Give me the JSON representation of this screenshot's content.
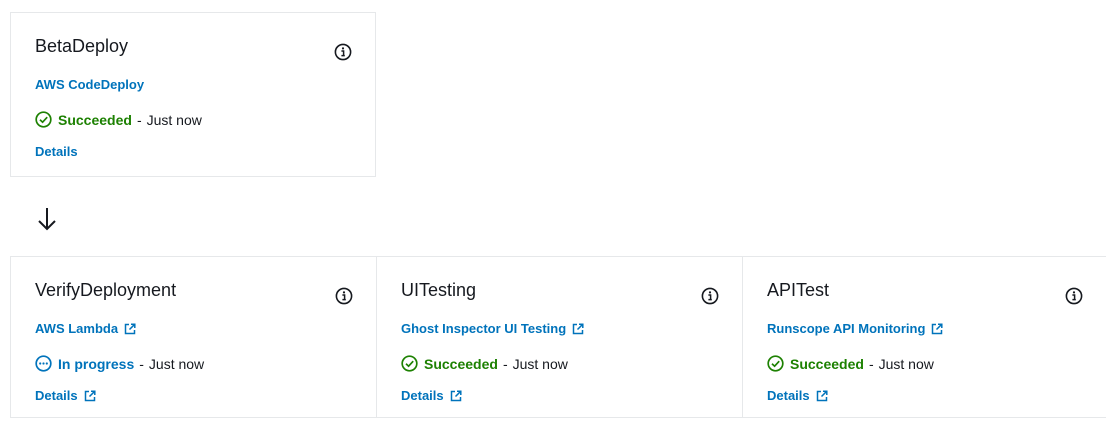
{
  "stages": [
    {
      "title": "BetaDeploy",
      "provider": "AWS CodeDeploy",
      "provider_external": false,
      "status": "Succeeded",
      "status_type": "succeeded",
      "separator": "-",
      "time": "Just now",
      "details": "Details",
      "details_external": false
    },
    {
      "title": "VerifyDeployment",
      "provider": "AWS Lambda",
      "provider_external": true,
      "status": "In progress",
      "status_type": "in-progress",
      "separator": "-",
      "time": "Just now",
      "details": "Details",
      "details_external": true
    },
    {
      "title": "UITesting",
      "provider": "Ghost Inspector UI Testing",
      "provider_external": true,
      "status": "Succeeded",
      "status_type": "succeeded",
      "separator": "-",
      "time": "Just now",
      "details": "Details",
      "details_external": true
    },
    {
      "title": "APITest",
      "provider": "Runscope API Monitoring",
      "provider_external": true,
      "status": "Succeeded",
      "status_type": "succeeded",
      "separator": "-",
      "time": "Just now",
      "details": "Details",
      "details_external": true
    }
  ],
  "colors": {
    "link": "#0073bb",
    "success": "#1d8102",
    "in_progress": "#0073bb",
    "text": "#16191f",
    "border": "#e6e8ea"
  },
  "icons": {
    "info": "info-icon",
    "success": "check-circle-icon",
    "in_progress": "ellipsis-circle-icon",
    "external": "external-link-icon",
    "flow_arrow": "arrow-down-icon"
  }
}
